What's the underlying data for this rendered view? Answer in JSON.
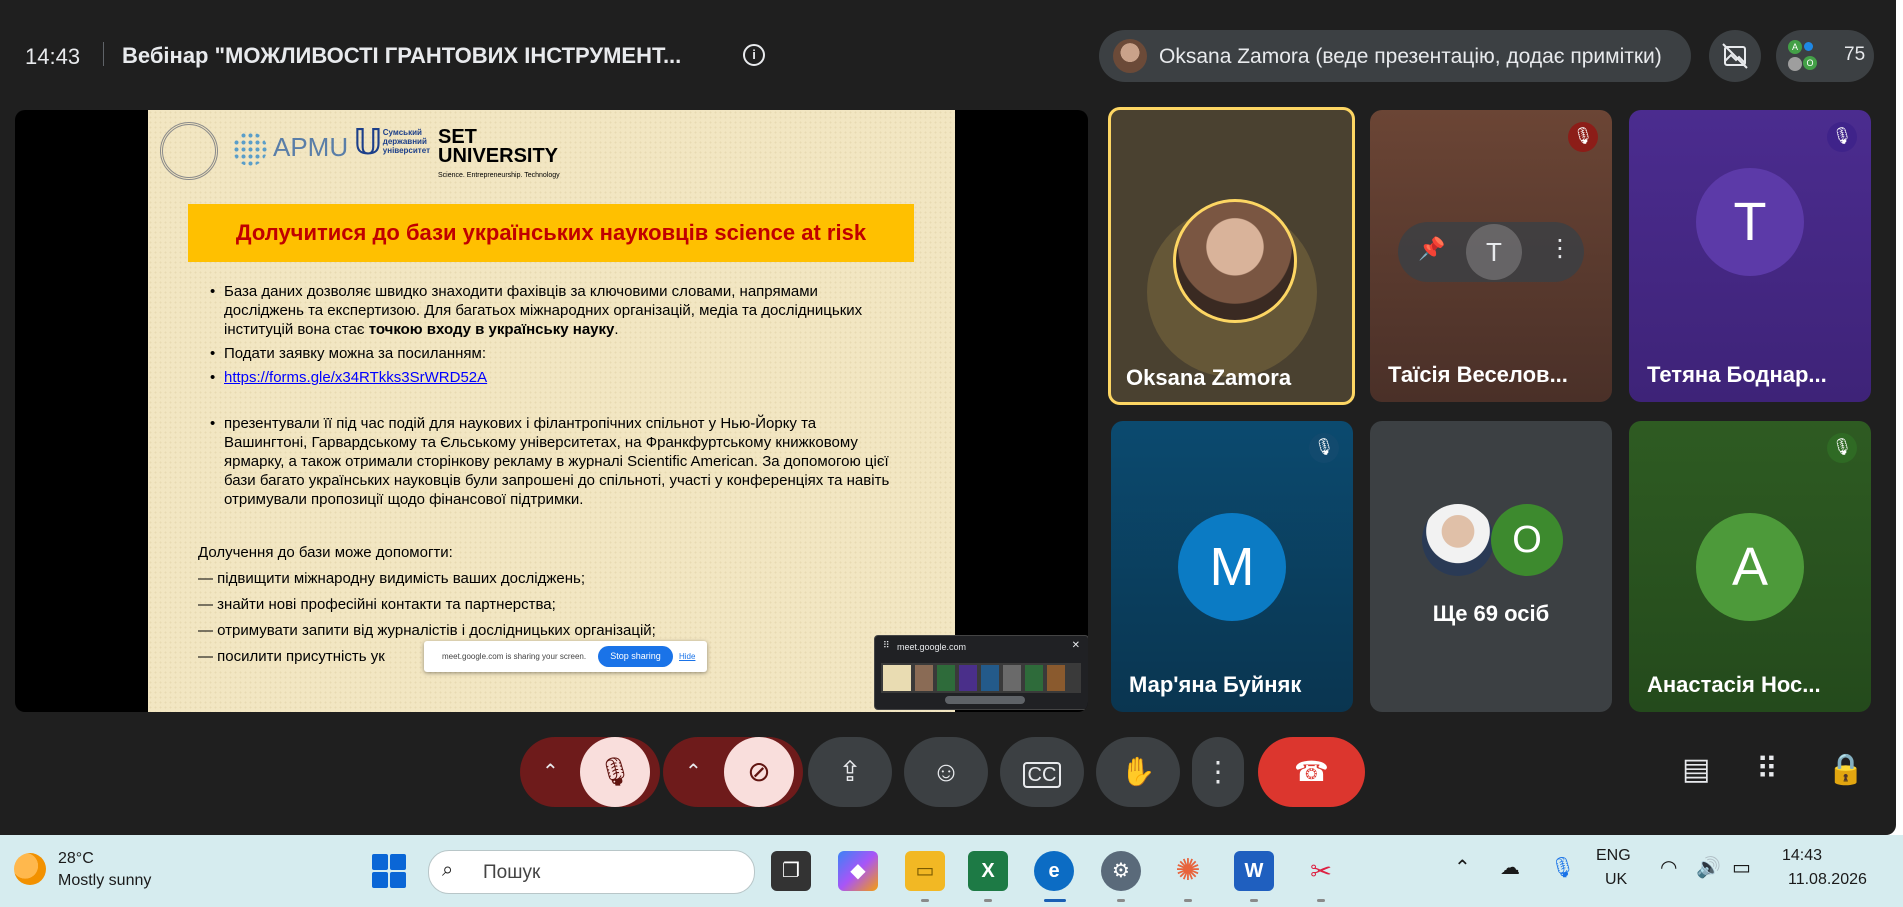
{
  "header": {
    "time": "14:43",
    "title": "Вебінар \"МОЖЛИВОСТІ ГРАНТОВИХ ІНСТРУМЕНТ...",
    "presenter": "Oksana Zamora (веде презентацію, додає примітки)",
    "participant_count": "75"
  },
  "slide": {
    "logo_apmu": "APMU",
    "logo_sumy": "Сумський державний університет",
    "logo_set": "SET UNIVERSITY",
    "logo_set_sub": "Science. Entrepreneurship. Technology",
    "title": "Долучитися до бази українських науковців science at risk",
    "bullet1_a": "База даних дозволяє швидко знаходити фахівців за ключовими словами, напрямами досліджень та експертизою. Для багатьох міжнародних організацій, медіа та дослідницьких інституцій вона стає ",
    "bullet1_bold": "точкою входу в українську науку",
    "bullet1_end": ".",
    "bullet2": "Подати заявку можна за посиланням:",
    "link": "https://forms.gle/x34RTkks3SrWRD52A",
    "bullet3": "презентували її під час подій для наукових і філантропічних спільнот у Нью-Йорку та Вашингтоні, Гарвардському та Єльському університетах, на Франкфуртському книжковому ярмарку, а також отримали сторінкову рекламу в журналі Scientific American. За допомогою цієї бази багато українських науковців були запрошені до спільноті, участі у конференціях та навіть отримували пропозиції щодо фінансової підтримки.",
    "help_title": "Долучення до бази може допомогти:",
    "help_items": [
      "— підвищити міжнародну видимість ваших досліджень;",
      "— знайти нові професійні контакти та партнерства;",
      "— отримувати запити від журналістів і дослідницьких організацій;",
      "— посилити присутність ук"
    ]
  },
  "share_bar": {
    "text": "meet.google.com is sharing your screen.",
    "stop": "Stop sharing",
    "hide": "Hide"
  },
  "pip": {
    "url": "meet.google.com"
  },
  "tiles": {
    "t1": "Oksana Zamora",
    "t2": "Таїсія Веселов...",
    "t3": "Тетяна Боднар...",
    "t3_letter": "T",
    "t4": "Мар'яна Буйняк",
    "t4_letter": "M",
    "t5": "Ще 69 осіб",
    "t5_letter": "O",
    "t6": "Анастасія Нос...",
    "t6_letter": "A"
  },
  "taskbar": {
    "temp": "28°C",
    "weather": "Mostly sunny",
    "search": "Пошук",
    "lang1": "ENG",
    "lang2": "UK",
    "time": "14:43",
    "date": "11.08.2026"
  },
  "colors": {
    "slide_title_bg": "#ffc000",
    "slide_title_text": "#c00000",
    "end_call": "#dc362e",
    "active_speaker_border": "#fdd663"
  }
}
